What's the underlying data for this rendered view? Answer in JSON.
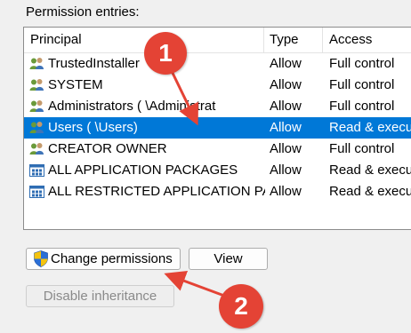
{
  "section_label": "Permission entries:",
  "columns": {
    "principal": "Principal",
    "type": "Type",
    "access": "Access"
  },
  "rows": [
    {
      "icon": "user-group-icon",
      "name": "TrustedInstaller",
      "type": "Allow",
      "access": "Full control",
      "selected": false
    },
    {
      "icon": "user-group-icon",
      "name": "SYSTEM",
      "type": "Allow",
      "access": "Full control",
      "selected": false
    },
    {
      "icon": "user-group-icon",
      "name": "Administrators (      \\Administrat",
      "type": "Allow",
      "access": "Full control",
      "selected": false
    },
    {
      "icon": "user-group-icon",
      "name": "Users (      \\Users)",
      "type": "Allow",
      "access": "Read & execu",
      "selected": true
    },
    {
      "icon": "user-group-icon",
      "name": "CREATOR OWNER",
      "type": "Allow",
      "access": "Full control",
      "selected": false
    },
    {
      "icon": "app-package-icon",
      "name": "ALL APPLICATION PACKAGES",
      "type": "Allow",
      "access": "Read & execu",
      "selected": false
    },
    {
      "icon": "app-package-icon",
      "name": "ALL RESTRICTED APPLICATION PA...",
      "type": "Allow",
      "access": "Read & execu",
      "selected": false
    }
  ],
  "buttons": {
    "change_permissions": "Change permissions",
    "view": "View",
    "disable_inheritance": "Disable inheritance"
  },
  "annotations": {
    "one": "1",
    "two": "2"
  },
  "colors": {
    "selection": "#0078d7",
    "annotation": "#e44335"
  }
}
